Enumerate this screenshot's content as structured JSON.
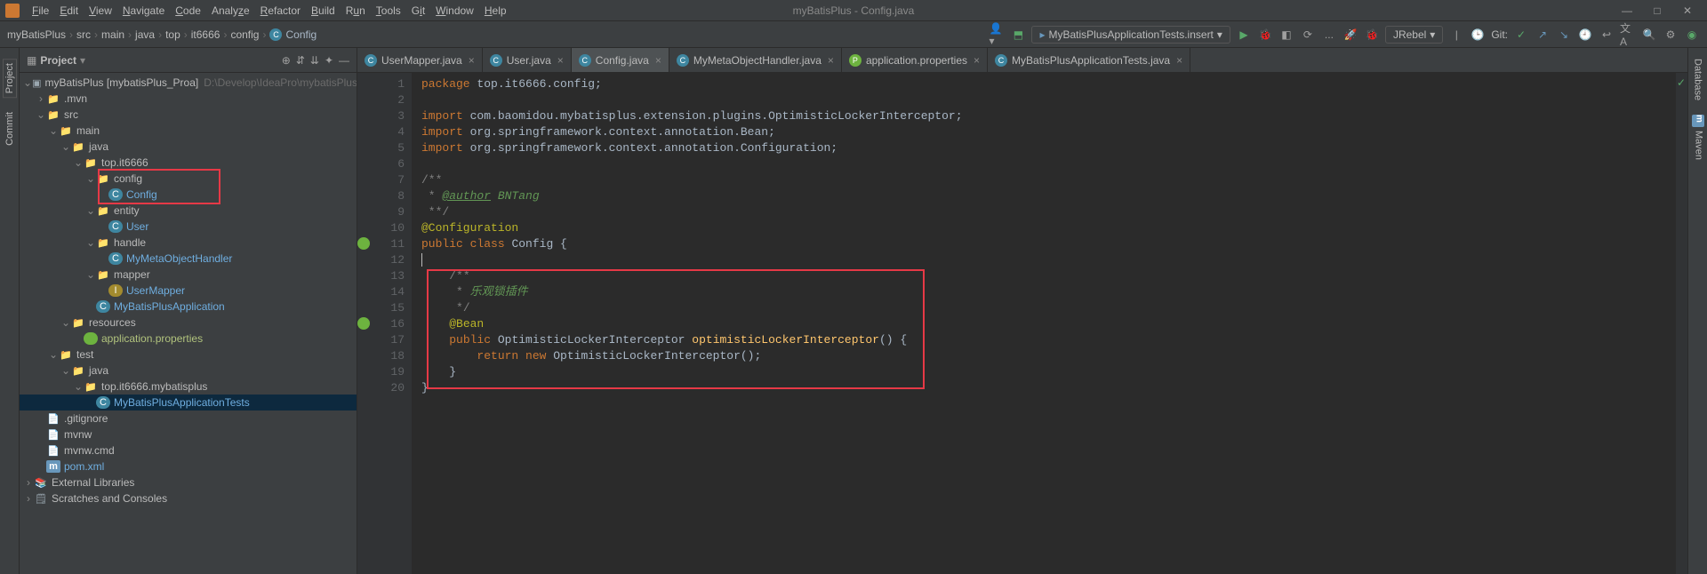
{
  "window": {
    "title": "myBatisPlus - Config.java"
  },
  "menubar": [
    "File",
    "Edit",
    "View",
    "Navigate",
    "Code",
    "Analyze",
    "Refactor",
    "Build",
    "Run",
    "Tools",
    "Git",
    "Window",
    "Help"
  ],
  "win_controls": {
    "min": "—",
    "max": "□",
    "close": "✕"
  },
  "breadcrumb": [
    "myBatisPlus",
    "src",
    "main",
    "java",
    "top",
    "it6666",
    "config",
    "Config"
  ],
  "runconfig": {
    "label": "MyBatisPlusApplicationTests.insert",
    "dropdown": "▾"
  },
  "jrebel": {
    "label": "JRebel",
    "dropdown": "▾"
  },
  "git_label": "Git:",
  "left_tools": [
    "Project",
    "Commit"
  ],
  "right_tools": [
    "Database",
    "Maven"
  ],
  "project_panel": {
    "title": "Project",
    "root_label": "myBatisPlus",
    "root_bold": "[mybatisPlus_Proa]",
    "root_path": "D:\\Develop\\IdeaPro\\mybatisPlus\\myBatis"
  },
  "tree": {
    "mvn": ".mvn",
    "src": "src",
    "main": "main",
    "java": "java",
    "topit": "top.it6666",
    "config_pkg": "config",
    "config_cls": "Config",
    "entity": "entity",
    "user": "User",
    "handle": "handle",
    "mmoh": "MyMetaObjectHandler",
    "mapper": "mapper",
    "usermapper": "UserMapper",
    "mbpa": "MyBatisPlusApplication",
    "resources": "resources",
    "appprops": "application.properties",
    "test": "test",
    "testjava": "java",
    "testpkg": "top.it6666.mybatisplus",
    "testcls": "MyBatisPlusApplicationTests",
    "gitignore": ".gitignore",
    "mvnw": "mvnw",
    "mvnwcmd": "mvnw.cmd",
    "pom": "pom.xml",
    "extlib": "External Libraries",
    "scratches": "Scratches and Consoles"
  },
  "tabs": [
    {
      "icon": "C",
      "label": "UserMapper.java",
      "active": false
    },
    {
      "icon": "C",
      "label": "User.java",
      "active": false
    },
    {
      "icon": "C",
      "label": "Config.java",
      "active": true
    },
    {
      "icon": "C",
      "label": "MyMetaObjectHandler.java",
      "active": false
    },
    {
      "icon": "P",
      "label": "application.properties",
      "active": false
    },
    {
      "icon": "C",
      "label": "MyBatisPlusApplicationTests.java",
      "active": false
    }
  ],
  "code_lines": [
    {
      "n": 1,
      "html": "<span class='kw'>package</span> <span class='pkg'>top.it6666.config</span>;"
    },
    {
      "n": 2,
      "html": ""
    },
    {
      "n": 3,
      "html": "<span class='kw'>import</span> <span class='pkg'>com.baomidou.mybatisplus.extension.plugins.OptimisticLockerInterceptor</span>;"
    },
    {
      "n": 4,
      "html": "<span class='kw'>import</span> <span class='pkg'>org.springframework.context.annotation.Bean</span>;"
    },
    {
      "n": 5,
      "html": "<span class='kw'>import</span> <span class='pkg'>org.springframework.context.annotation.Configuration</span>;"
    },
    {
      "n": 6,
      "html": ""
    },
    {
      "n": 7,
      "html": "<span class='comment'>/**</span>"
    },
    {
      "n": 8,
      "html": "<span class='comment'> * </span><span class='doctag'>@author</span><span class='docitalic'> BNTang</span>"
    },
    {
      "n": 9,
      "html": "<span class='comment'> **/</span>"
    },
    {
      "n": 10,
      "html": "<span class='ann'>@Configuration</span>"
    },
    {
      "n": 11,
      "html": "<span class='kw'>public class</span> <span class='type'>Config</span> {",
      "gicon": true
    },
    {
      "n": 12,
      "html": "<span class='caret'></span>"
    },
    {
      "n": 13,
      "html": "    <span class='comment'>/**</span>"
    },
    {
      "n": 14,
      "html": "    <span class='comment'> * </span><span class='docitalic'>乐观锁插件</span>"
    },
    {
      "n": 15,
      "html": "    <span class='comment'> */</span>"
    },
    {
      "n": 16,
      "html": "    <span class='ann'>@Bean</span>",
      "gicon": true
    },
    {
      "n": 17,
      "html": "    <span class='kw'>public</span> <span class='type'>OptimisticLockerInterceptor</span> <span class='mtd'>optimisticLockerInterceptor</span>() {"
    },
    {
      "n": 18,
      "html": "        <span class='kw'>return new</span> OptimisticLockerInterceptor();"
    },
    {
      "n": 19,
      "html": "    }"
    },
    {
      "n": 20,
      "html": "}"
    }
  ]
}
